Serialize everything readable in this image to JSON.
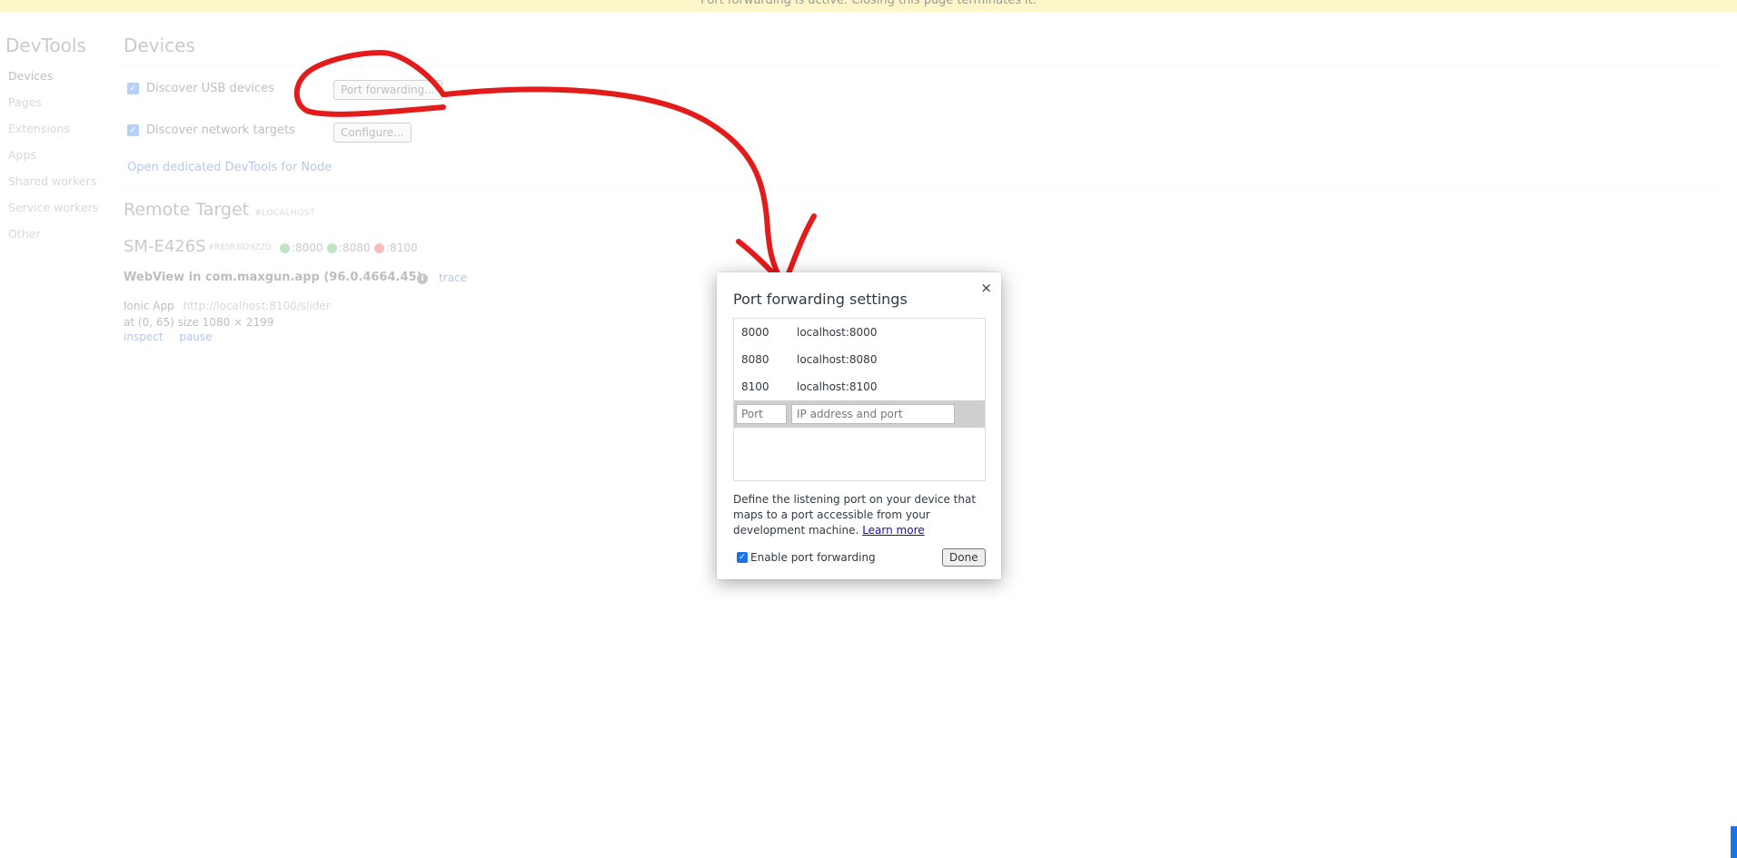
{
  "banner": {
    "text": "Port forwarding is active. Closing this page terminates it."
  },
  "sidebar": {
    "logo": "DevTools",
    "items": [
      {
        "label": "Devices",
        "selected": true
      },
      {
        "label": "Pages"
      },
      {
        "label": "Extensions"
      },
      {
        "label": "Apps"
      },
      {
        "label": "Shared workers"
      },
      {
        "label": "Service workers"
      },
      {
        "label": "Other"
      }
    ]
  },
  "devices": {
    "title": "Devices",
    "discover_usb_label": "Discover USB devices",
    "discover_usb_checked": true,
    "port_forwarding_button": "Port forwarding...",
    "discover_network_label": "Discover network targets",
    "discover_network_checked": true,
    "configure_button": "Configure...",
    "node_link": "Open dedicated DevTools for Node"
  },
  "remote_target": {
    "title": "Remote Target",
    "subtitle": "#LOCALHOST",
    "device_name": "SM-E426S",
    "device_serial": "#R8SR3029ZZD",
    "ports": [
      {
        "label": ":8000",
        "status": "green"
      },
      {
        "label": ":8080",
        "status": "green"
      },
      {
        "label": ":8100",
        "status": "red"
      }
    ],
    "webview_title": "WebView in com.maxgun.app (96.0.4664.45)",
    "trace_link": "trace",
    "app_name": "Ionic App",
    "app_url": "http://localhost:8100/slider",
    "position_text": "at (0, 65)  size 1080 × 2199",
    "inspect_link": "inspect",
    "pause_link": "pause"
  },
  "dialog": {
    "title": "Port forwarding settings",
    "close_glyph": "×",
    "rules": [
      {
        "port": "8000",
        "address": "localhost:8000"
      },
      {
        "port": "8080",
        "address": "localhost:8080"
      },
      {
        "port": "8100",
        "address": "localhost:8100"
      }
    ],
    "port_placeholder": "Port",
    "address_placeholder": "IP address and port",
    "help_text": "Define the listening port on your device that maps to a port accessible from your development machine.",
    "learn_more": "Learn more",
    "enable_label": "Enable port forwarding",
    "enable_checked": true,
    "done_button": "Done"
  },
  "colors": {
    "banner": "#fdf6c8",
    "accent": "#1a73e8",
    "annotation": "#e31b1b",
    "status_green": "#3cb043",
    "status_red": "#e53935"
  },
  "icons": {
    "close": "close-icon",
    "info": "info-icon",
    "checkbox": "checkmark-icon"
  }
}
